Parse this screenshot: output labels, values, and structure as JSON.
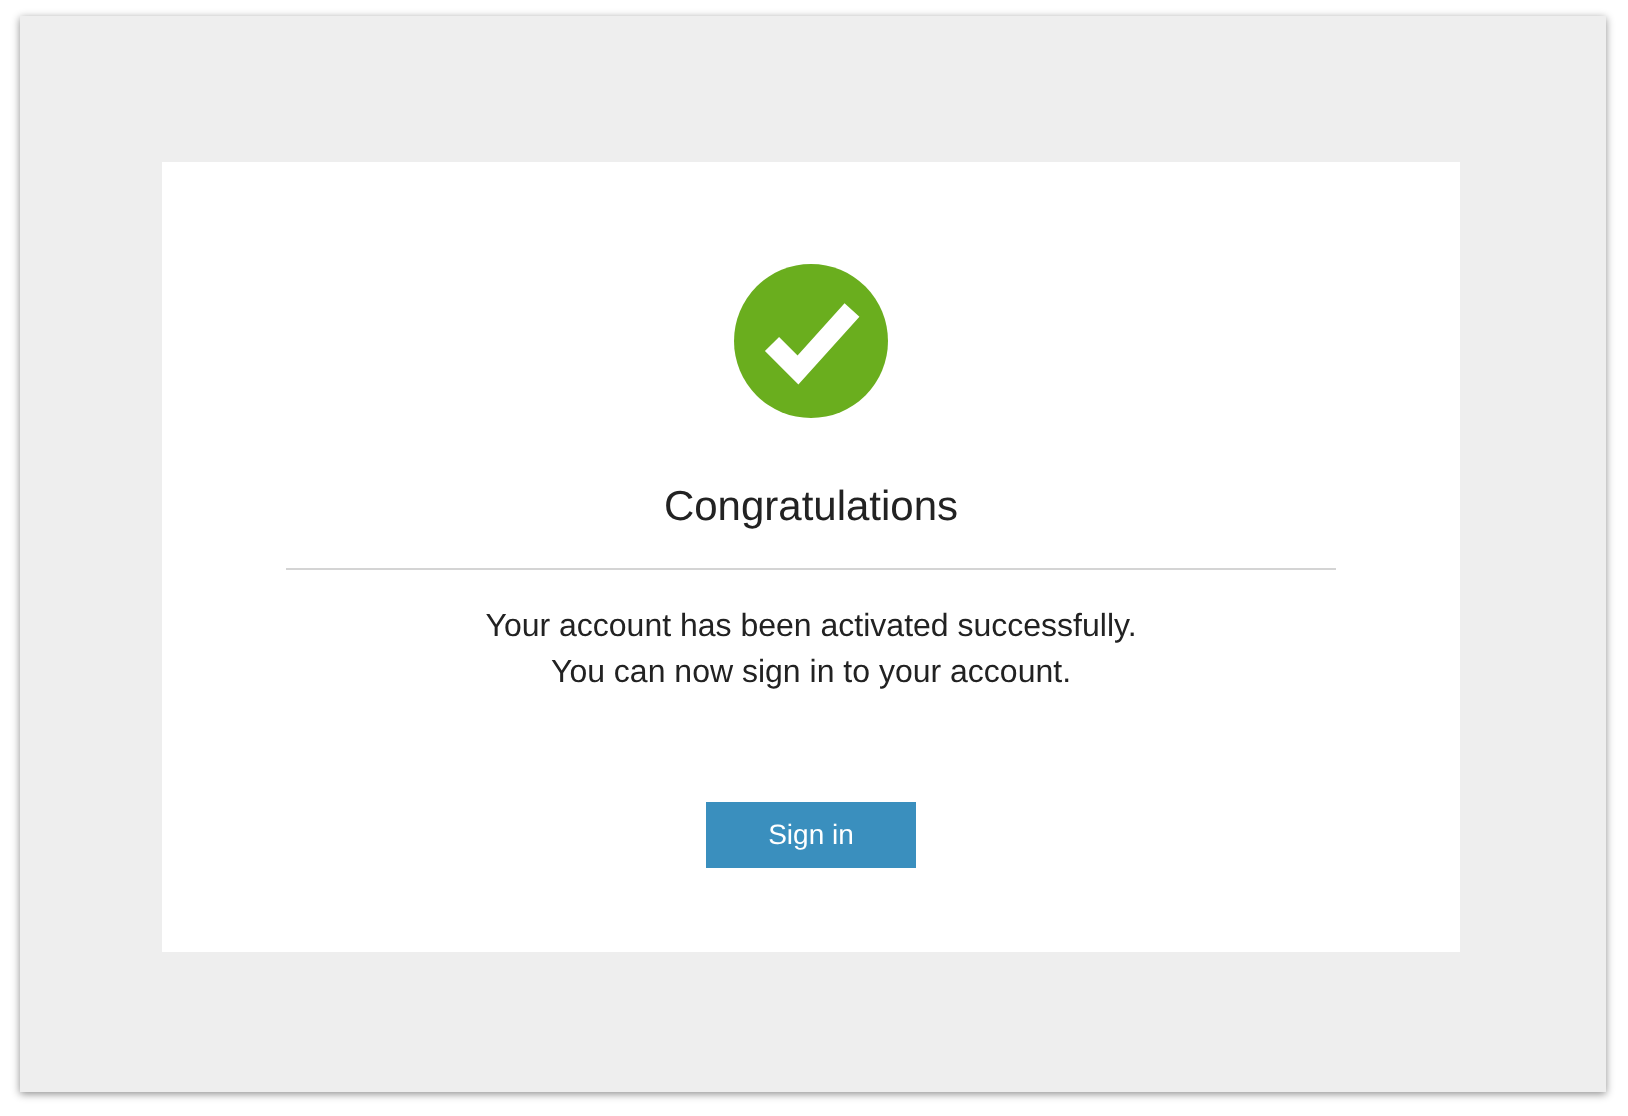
{
  "title": "Congratulations",
  "message": [
    "Your account has been activated successfully.",
    "You can now sign in to your account."
  ],
  "button": "Sign in"
}
